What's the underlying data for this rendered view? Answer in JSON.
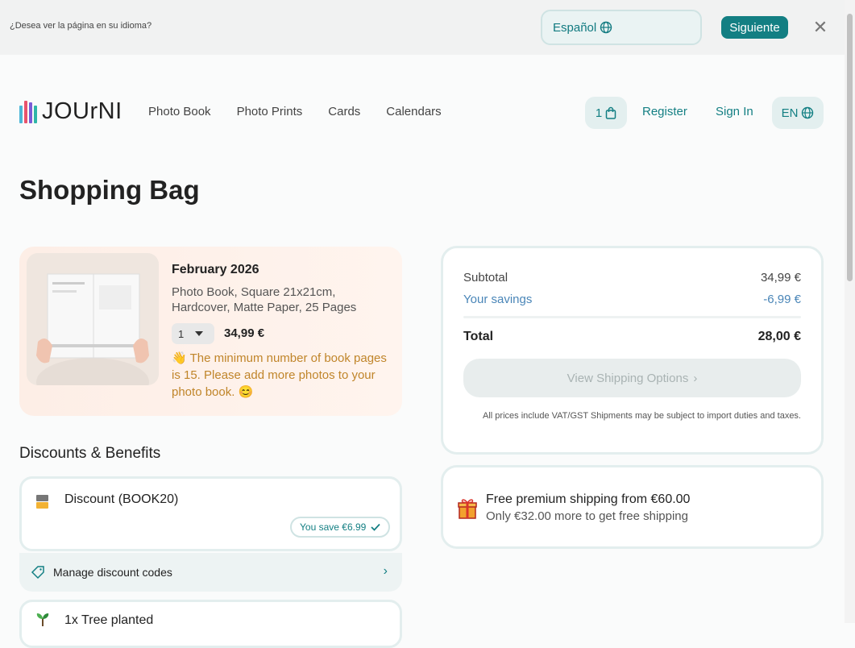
{
  "banner": {
    "question": "¿Desea ver la página en su idioma?",
    "language": "Español",
    "next_label": "Siguiente",
    "close": "✕"
  },
  "header": {
    "logo_text": "JOUrNI",
    "nav": [
      "Photo Book",
      "Photo Prints",
      "Cards",
      "Calendars"
    ],
    "cart_count": "1",
    "register": "Register",
    "sign_in": "Sign In",
    "lang": "EN"
  },
  "page": {
    "title": "Shopping Bag"
  },
  "product": {
    "name": "February 2026",
    "description": "Photo Book, Square 21x21cm, Hardcover, Matte Paper, 25 Pages",
    "quantity": "1",
    "price": "34,99 €",
    "warning": "The minimum number of book pages is 15. Please add more photos to your photo book.",
    "warning_icon": "👋",
    "warning_end_icon": "😊"
  },
  "discounts": {
    "title": "Discounts & Benefits",
    "discount_label": "Discount (BOOK20)",
    "you_save": "You save €6.99",
    "manage_label": "Manage discount codes",
    "tree_label": "1x Tree planted"
  },
  "summary": {
    "subtotal_label": "Subtotal",
    "subtotal_value": "34,99 €",
    "savings_label": "Your savings",
    "savings_value": "-6,99 €",
    "total_label": "Total",
    "total_value": "28,00 €",
    "ship_button": "View Shipping Options",
    "vat_note": "All prices include VAT/GST Shipments may be subject to import duties and taxes."
  },
  "shipping_promo": {
    "title": "Free premium shipping from €60.00",
    "subtitle": "Only €32.00 more to get free shipping"
  },
  "colors": {
    "accent": "#137f83",
    "warning": "#c0852a",
    "savings": "#4a86b8"
  }
}
